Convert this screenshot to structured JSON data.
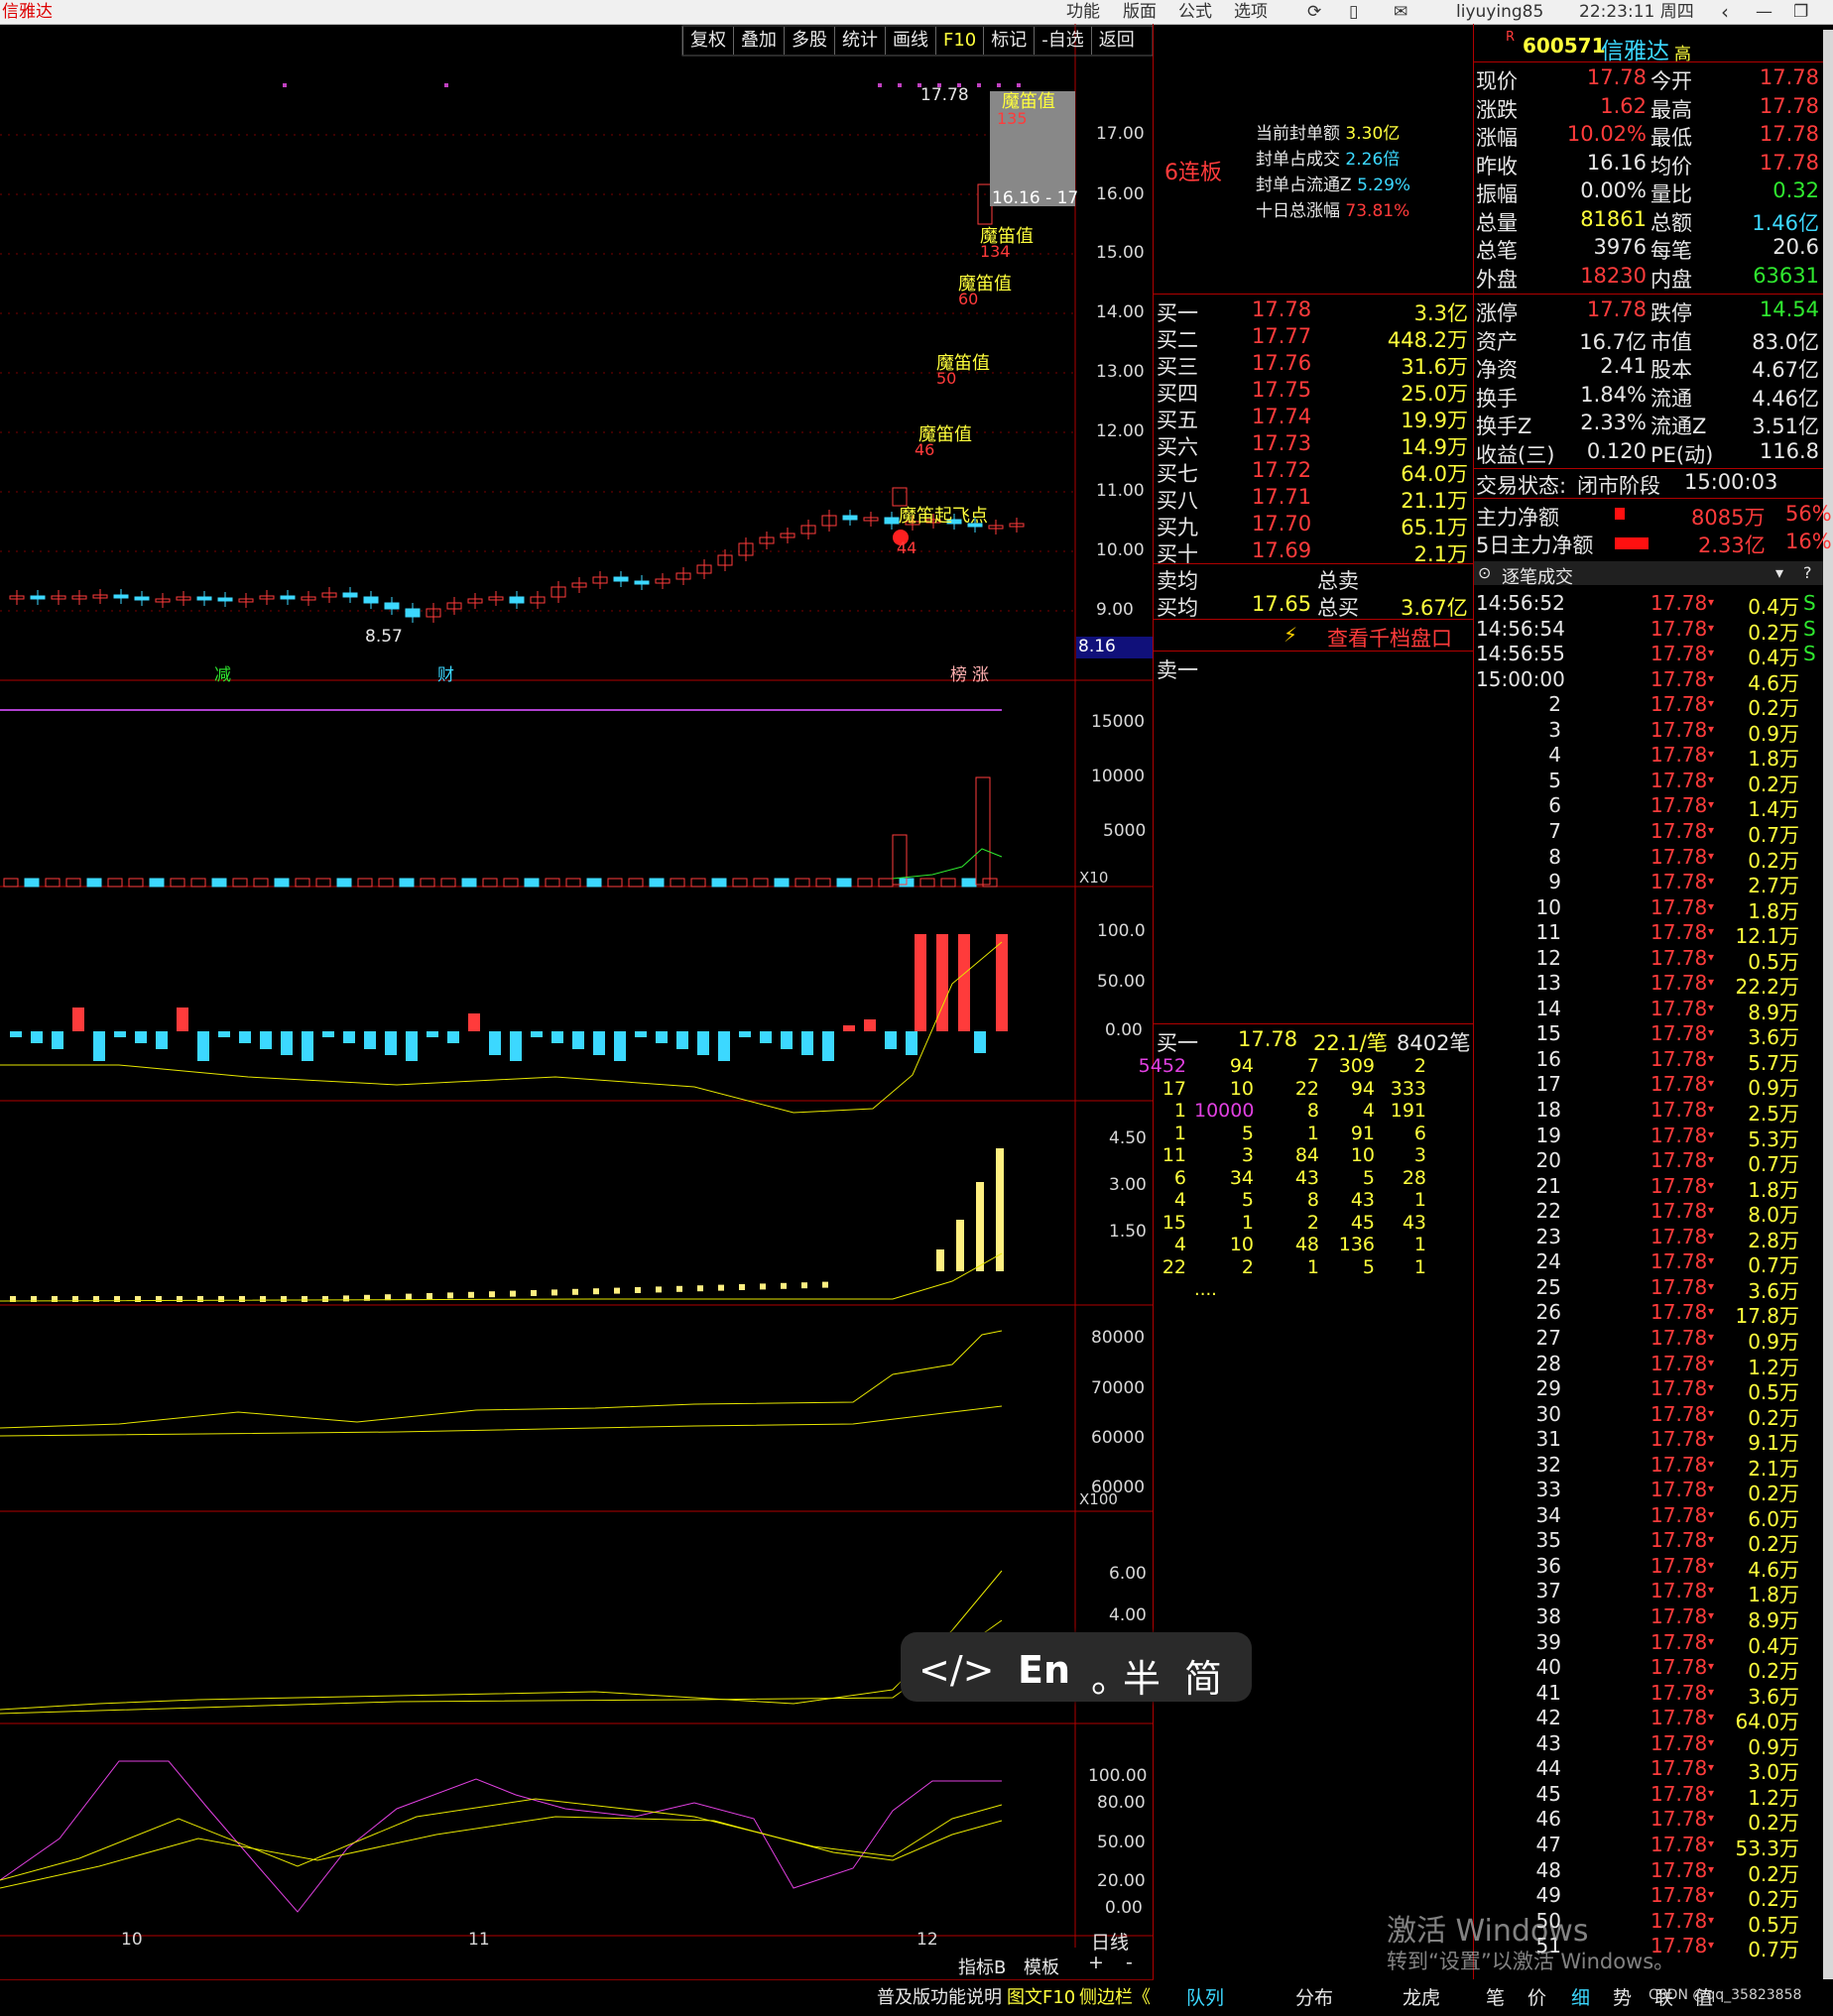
{
  "window": {
    "title": "信雅达",
    "menu": [
      "功能",
      "版面",
      "公式",
      "选项"
    ],
    "user": "liyuying85",
    "time": "22:23:11 周四"
  },
  "toolbar": [
    "复权",
    "叠加",
    "多股",
    "统计",
    "画线",
    "F10",
    "标记",
    "-自选",
    "返回"
  ],
  "stock": {
    "code": "600571",
    "name": "信雅达",
    "flag": "高",
    "prefix": "R"
  },
  "price_axis": [
    "17.00",
    "16.00",
    "15.00",
    "14.00",
    "13.00",
    "12.00",
    "11.00",
    "10.00",
    "9.00"
  ],
  "price_marks": {
    "high": "17.78",
    "low": "8.57",
    "cursor_price": "8.16",
    "range_label": "16.16 - 17"
  },
  "annotations": [
    {
      "text": "魔笛值",
      "num": "135"
    },
    {
      "text": "魔笛值",
      "num": "134"
    },
    {
      "text": "魔笛值",
      "num": "60"
    },
    {
      "text": "魔笛值",
      "num": "50"
    },
    {
      "text": "魔笛值",
      "num": "46"
    },
    {
      "text": "魔笛起飞点",
      "num": "44"
    }
  ],
  "event_tags": [
    "减",
    "财",
    "榜",
    "涨"
  ],
  "vol_axis": [
    "15000",
    "10000",
    "5000"
  ],
  "vol_unit": "X10",
  "ind1_axis": [
    "100.0",
    "50.00",
    "0.00"
  ],
  "ind2_axis": [
    "4.50",
    "3.00",
    "1.50"
  ],
  "ind3_axis": [
    "80000",
    "70000",
    "60000",
    "60000"
  ],
  "ind3_unit": "X100",
  "ind4_axis": [
    "6.00",
    "4.00"
  ],
  "ind5_axis": [
    "100.00",
    "80.00",
    "50.00",
    "20.00",
    "0.00"
  ],
  "date_axis": [
    "10",
    "11",
    "12"
  ],
  "bottom_tabs": [
    "日线",
    "指标B",
    "模板",
    "+",
    "-"
  ],
  "bottom_status": [
    "普及版功能说明",
    "图文F10",
    "侧边栏《"
  ],
  "lianban": "6连板",
  "seal_info": [
    {
      "label": "当前封单额",
      "value": "3.30亿"
    },
    {
      "label": "封单占成交",
      "value": "2.26倍"
    },
    {
      "label": "封单占流通Z",
      "value": "5.29%"
    },
    {
      "label": "十日总涨幅",
      "value": "73.81%"
    }
  ],
  "quote": [
    {
      "l1": "现价",
      "v1": "17.78",
      "l2": "今开",
      "v2": "17.78"
    },
    {
      "l1": "涨跌",
      "v1": "1.62",
      "l2": "最高",
      "v2": "17.78"
    },
    {
      "l1": "涨幅",
      "v1": "10.02%",
      "l2": "最低",
      "v2": "17.78"
    },
    {
      "l1": "昨收",
      "v1": "16.16",
      "l2": "均价",
      "v2": "17.78"
    },
    {
      "l1": "振幅",
      "v1": "0.00%",
      "l2": "量比",
      "v2": "0.32"
    },
    {
      "l1": "总量",
      "v1": "81861",
      "l2": "总额",
      "v2": "1.46亿"
    },
    {
      "l1": "总笔",
      "v1": "3976",
      "l2": "每笔",
      "v2": "20.6"
    },
    {
      "l1": "外盘",
      "v1": "18230",
      "l2": "内盘",
      "v2": "63631"
    }
  ],
  "quote2": [
    {
      "l1": "涨停",
      "v1": "17.78",
      "l2": "跌停",
      "v2": "14.54"
    },
    {
      "l1": "资产",
      "v1": "16.7亿",
      "l2": "市值",
      "v2": "83.0亿"
    },
    {
      "l1": "净资",
      "v1": "2.41",
      "l2": "股本",
      "v2": "4.67亿"
    },
    {
      "l1": "换手",
      "v1": "1.84%",
      "l2": "流通",
      "v2": "4.46亿"
    },
    {
      "l1": "换手Z",
      "v1": "2.33%",
      "l2": "流通Z",
      "v2": "3.51亿"
    },
    {
      "l1": "收益(三)",
      "v1": "0.120",
      "l2": "PE(动)",
      "v2": "116.8"
    }
  ],
  "trade_status": {
    "label": "交易状态:",
    "value": "闭市阶段",
    "time": "15:00:03"
  },
  "main_flow": [
    {
      "label": "主力净额",
      "value": "8085万",
      "pct": "56%"
    },
    {
      "label": "5日主力净额",
      "value": "2.33亿",
      "pct": "16%"
    }
  ],
  "bids": [
    {
      "label": "买一",
      "price": "17.78",
      "vol": "3.3亿"
    },
    {
      "label": "买二",
      "price": "17.77",
      "vol": "448.2万"
    },
    {
      "label": "买三",
      "price": "17.76",
      "vol": "31.6万"
    },
    {
      "label": "买四",
      "price": "17.75",
      "vol": "25.0万"
    },
    {
      "label": "买五",
      "price": "17.74",
      "vol": "19.9万"
    },
    {
      "label": "买六",
      "price": "17.73",
      "vol": "14.9万"
    },
    {
      "label": "买七",
      "price": "17.72",
      "vol": "64.0万"
    },
    {
      "label": "买八",
      "price": "17.71",
      "vol": "21.1万"
    },
    {
      "label": "买九",
      "price": "17.70",
      "vol": "65.1万"
    },
    {
      "label": "买十",
      "price": "17.69",
      "vol": "2.1万"
    }
  ],
  "avg": {
    "sell_label": "卖均",
    "sell_total_label": "总卖",
    "buy_label": "买均",
    "buy_price": "17.65",
    "buy_total_label": "总买",
    "buy_total": "3.67亿"
  },
  "thousand_link": "查看千档盘口",
  "sell1": "卖一",
  "queue_head": {
    "label": "买一",
    "price": "17.78",
    "per": "22.1/笔",
    "count": "8402笔"
  },
  "queue": [
    [
      "5452",
      "94",
      "7",
      "309",
      "2"
    ],
    [
      "17",
      "10",
      "22",
      "94",
      "333"
    ],
    [
      "1",
      "10000",
      "8",
      "4",
      "191"
    ],
    [
      "1",
      "5",
      "1",
      "91",
      "6"
    ],
    [
      "11",
      "3",
      "84",
      "10",
      "3"
    ],
    [
      "6",
      "34",
      "43",
      "5",
      "28"
    ],
    [
      "4",
      "5",
      "8",
      "43",
      "1"
    ],
    [
      "15",
      "1",
      "2",
      "45",
      "43"
    ],
    [
      "4",
      "10",
      "48",
      "136",
      "1"
    ],
    [
      "22",
      "2",
      "1",
      "5",
      "1"
    ]
  ],
  "queue_more": "....",
  "ticks_title": "逐笔成交",
  "ticks": [
    {
      "t": "14:56:52",
      "p": "17.78",
      "v": "0.4万",
      "s": "S"
    },
    {
      "t": "14:56:54",
      "p": "17.78",
      "v": "0.2万",
      "s": "S"
    },
    {
      "t": "14:56:55",
      "p": "17.78",
      "v": "0.4万",
      "s": "S"
    },
    {
      "t": "15:00:00",
      "p": "17.78",
      "v": "4.6万",
      "s": ""
    },
    {
      "t": "2",
      "p": "17.78",
      "v": "0.2万",
      "s": ""
    },
    {
      "t": "3",
      "p": "17.78",
      "v": "0.9万",
      "s": ""
    },
    {
      "t": "4",
      "p": "17.78",
      "v": "1.8万",
      "s": ""
    },
    {
      "t": "5",
      "p": "17.78",
      "v": "0.2万",
      "s": ""
    },
    {
      "t": "6",
      "p": "17.78",
      "v": "1.4万",
      "s": ""
    },
    {
      "t": "7",
      "p": "17.78",
      "v": "0.7万",
      "s": ""
    },
    {
      "t": "8",
      "p": "17.78",
      "v": "0.2万",
      "s": ""
    },
    {
      "t": "9",
      "p": "17.78",
      "v": "2.7万",
      "s": ""
    },
    {
      "t": "10",
      "p": "17.78",
      "v": "1.8万",
      "s": ""
    },
    {
      "t": "11",
      "p": "17.78",
      "v": "12.1万",
      "s": ""
    },
    {
      "t": "12",
      "p": "17.78",
      "v": "0.5万",
      "s": ""
    },
    {
      "t": "13",
      "p": "17.78",
      "v": "22.2万",
      "s": ""
    },
    {
      "t": "14",
      "p": "17.78",
      "v": "8.9万",
      "s": ""
    },
    {
      "t": "15",
      "p": "17.78",
      "v": "3.6万",
      "s": ""
    },
    {
      "t": "16",
      "p": "17.78",
      "v": "5.7万",
      "s": ""
    },
    {
      "t": "17",
      "p": "17.78",
      "v": "0.9万",
      "s": ""
    },
    {
      "t": "18",
      "p": "17.78",
      "v": "2.5万",
      "s": ""
    },
    {
      "t": "19",
      "p": "17.78",
      "v": "5.3万",
      "s": ""
    },
    {
      "t": "20",
      "p": "17.78",
      "v": "0.7万",
      "s": ""
    },
    {
      "t": "21",
      "p": "17.78",
      "v": "1.8万",
      "s": ""
    },
    {
      "t": "22",
      "p": "17.78",
      "v": "8.0万",
      "s": ""
    },
    {
      "t": "23",
      "p": "17.78",
      "v": "2.8万",
      "s": ""
    },
    {
      "t": "24",
      "p": "17.78",
      "v": "0.7万",
      "s": ""
    },
    {
      "t": "25",
      "p": "17.78",
      "v": "3.6万",
      "s": ""
    },
    {
      "t": "26",
      "p": "17.78",
      "v": "17.8万",
      "s": ""
    },
    {
      "t": "27",
      "p": "17.78",
      "v": "0.9万",
      "s": ""
    },
    {
      "t": "28",
      "p": "17.78",
      "v": "1.2万",
      "s": ""
    },
    {
      "t": "29",
      "p": "17.78",
      "v": "0.5万",
      "s": ""
    },
    {
      "t": "30",
      "p": "17.78",
      "v": "0.2万",
      "s": ""
    },
    {
      "t": "31",
      "p": "17.78",
      "v": "9.1万",
      "s": ""
    },
    {
      "t": "32",
      "p": "17.78",
      "v": "2.1万",
      "s": ""
    },
    {
      "t": "33",
      "p": "17.78",
      "v": "0.2万",
      "s": ""
    },
    {
      "t": "34",
      "p": "17.78",
      "v": "6.0万",
      "s": ""
    },
    {
      "t": "35",
      "p": "17.78",
      "v": "0.2万",
      "s": ""
    },
    {
      "t": "36",
      "p": "17.78",
      "v": "4.6万",
      "s": ""
    },
    {
      "t": "37",
      "p": "17.78",
      "v": "1.8万",
      "s": ""
    },
    {
      "t": "38",
      "p": "17.78",
      "v": "8.9万",
      "s": ""
    },
    {
      "t": "39",
      "p": "17.78",
      "v": "0.4万",
      "s": ""
    },
    {
      "t": "40",
      "p": "17.78",
      "v": "0.2万",
      "s": ""
    },
    {
      "t": "41",
      "p": "17.78",
      "v": "3.6万",
      "s": ""
    },
    {
      "t": "42",
      "p": "17.78",
      "v": "64.0万",
      "s": ""
    },
    {
      "t": "43",
      "p": "17.78",
      "v": "0.9万",
      "s": ""
    },
    {
      "t": "44",
      "p": "17.78",
      "v": "3.0万",
      "s": ""
    },
    {
      "t": "45",
      "p": "17.78",
      "v": "1.2万",
      "s": ""
    },
    {
      "t": "46",
      "p": "17.78",
      "v": "0.2万",
      "s": ""
    },
    {
      "t": "47",
      "p": "17.78",
      "v": "53.3万",
      "s": ""
    },
    {
      "t": "48",
      "p": "17.78",
      "v": "0.2万",
      "s": ""
    },
    {
      "t": "49",
      "p": "17.78",
      "v": "0.2万",
      "s": ""
    },
    {
      "t": "50",
      "p": "17.78",
      "v": "0.5万",
      "s": ""
    },
    {
      "t": "51",
      "p": "17.78",
      "v": "0.7万",
      "s": ""
    }
  ],
  "bottom_right_tabs": [
    "队列",
    "分布",
    "龙虎",
    "笔",
    "价",
    "细",
    "势",
    "联",
    "值"
  ],
  "watermark": {
    "line1": "激活 Windows",
    "line2": "转到“设置”以激活 Windows。"
  },
  "ime": {
    "code": "</>",
    "lang": "En",
    "dot": "。",
    "half": "半",
    "simp": "简"
  },
  "footer_id": "CSDN @qq_35823858",
  "colors": {
    "up": "#ff3b3b",
    "down": "#3cd8ff",
    "ma": "#ffff3c",
    "grid": "#b00000",
    "bg": "#000000"
  }
}
